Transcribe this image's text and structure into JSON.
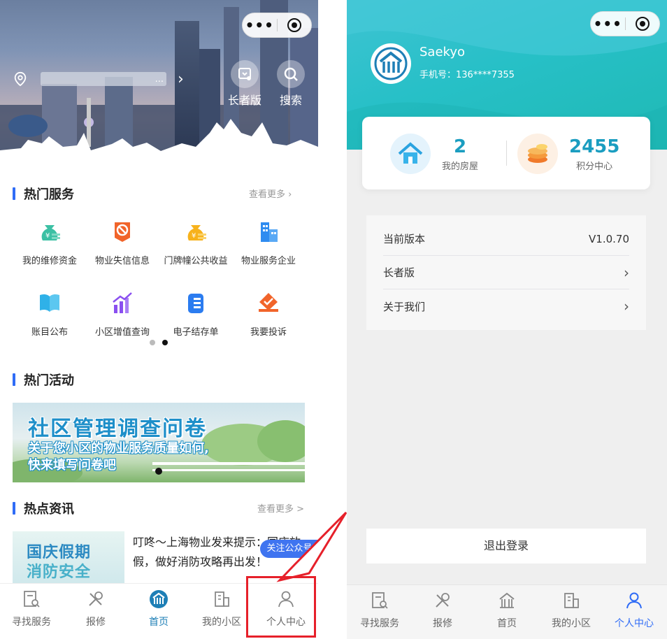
{
  "capsule": {
    "more_icon": "more-dots-icon",
    "close_icon": "target-circle-icon"
  },
  "left": {
    "address": {
      "icon": "location-pin-icon",
      "text": "...",
      "arrow": "›"
    },
    "hero_buttons": [
      {
        "label": "长者版",
        "icon": "elder-mode-icon"
      },
      {
        "label": "搜索",
        "icon": "search-icon"
      }
    ],
    "hot_services": {
      "title": "热门服务",
      "more": "查看更多 ›",
      "items": [
        {
          "label": "我的维修资金",
          "icon": "money-bag-icon"
        },
        {
          "label": "物业失信信息",
          "icon": "prohibited-icon"
        },
        {
          "label": "门牌幢公共收益",
          "icon": "money-bag-gold-icon"
        },
        {
          "label": "物业服务企业",
          "icon": "buildings-icon"
        },
        {
          "label": "账目公布",
          "icon": "book-icon"
        },
        {
          "label": "小区增值查询",
          "icon": "chart-up-icon"
        },
        {
          "label": "电子结存单",
          "icon": "document-icon"
        },
        {
          "label": "我要投诉",
          "icon": "complaint-icon"
        }
      ]
    },
    "hot_activities": {
      "title": "热门活动",
      "banner_title": "社区管理调查问卷",
      "banner_line1": "关于您小区的物业服务质量如何,",
      "banner_line2": "快来填写问卷吧"
    },
    "hot_news": {
      "title": "热点资讯",
      "more": "查看更多 >",
      "thumb_line1": "国庆假期",
      "thumb_line2": "消防安全",
      "headline": "叮咚～上海物业发来提示：国庆放假，做好消防攻略再出发！",
      "follow_label": "关注公众号"
    },
    "tabs": [
      {
        "label": "寻找服务",
        "icon": "search-doc-icon"
      },
      {
        "label": "报修",
        "icon": "tools-icon"
      },
      {
        "label": "首页",
        "icon": "home-logo-icon"
      },
      {
        "label": "我的小区",
        "icon": "building-icon"
      },
      {
        "label": "个人中心",
        "icon": "person-icon"
      }
    ],
    "active_tab": "首页"
  },
  "right": {
    "user": {
      "name": "Saekyo",
      "phone": "手机号：136****7355"
    },
    "stats": [
      {
        "value": "2",
        "label": "我的房屋",
        "icon": "house-icon"
      },
      {
        "value": "2455",
        "label": "积分中心",
        "icon": "coins-icon"
      }
    ],
    "settings": [
      {
        "label": "当前版本",
        "value": "V1.0.70"
      },
      {
        "label": "长者版",
        "value": "›"
      },
      {
        "label": "关于我们",
        "value": "›"
      }
    ],
    "logout": "退出登录",
    "tabs": [
      {
        "label": "寻找服务",
        "icon": "search-doc-icon"
      },
      {
        "label": "报修",
        "icon": "tools-icon"
      },
      {
        "label": "首页",
        "icon": "home-logo-icon"
      },
      {
        "label": "我的小区",
        "icon": "building-icon"
      },
      {
        "label": "个人中心",
        "icon": "person-icon"
      }
    ],
    "active_tab": "个人中心"
  },
  "colors": {
    "accent_blue": "#2f6cf6",
    "teal": "#27c0c7",
    "highlight_red": "#e6202a"
  }
}
